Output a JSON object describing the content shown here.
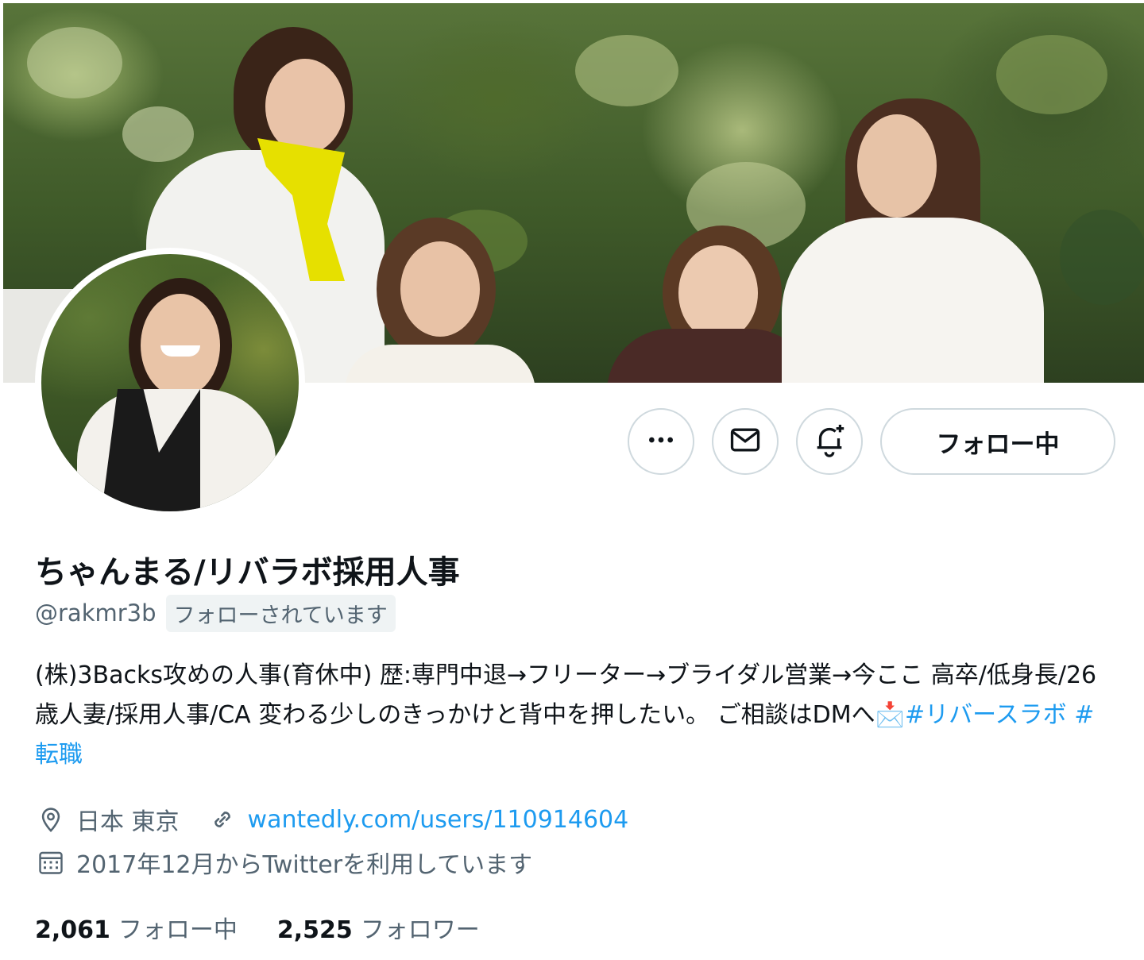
{
  "profile": {
    "display_name": "ちゃんまる/リバラボ採用人事",
    "handle": "@rakmr3b",
    "follows_you_badge": "フォローされています",
    "bio_text": "(株)3Backs攻めの人事(育休中) 歴:専門中退→フリーター→ブライダル営業→今ここ 高卒/低身長/26歳人妻/採用人事/CA 変わる少しのきっかけと背中を押したい。 ご相談はDMへ",
    "bio_emoji": "📩",
    "bio_hashtags": [
      "#リバースラボ",
      "#転職"
    ],
    "location": "日本 東京",
    "website": "wantedly.com/users/110914604",
    "joined": "2017年12月からTwitterを利用しています"
  },
  "actions": {
    "follow_button_label": "フォロー中",
    "more_icon": "more-icon",
    "message_icon": "mail-icon",
    "notify_icon": "bell-plus-icon"
  },
  "stats": {
    "following_count": "2,061",
    "following_label": "フォロー中",
    "followers_count": "2,525",
    "followers_label": "フォロワー"
  },
  "colors": {
    "link": "#1d9bf0",
    "secondary_text": "#536471",
    "border": "#cfd9de",
    "badge_bg": "#eff3f4"
  }
}
